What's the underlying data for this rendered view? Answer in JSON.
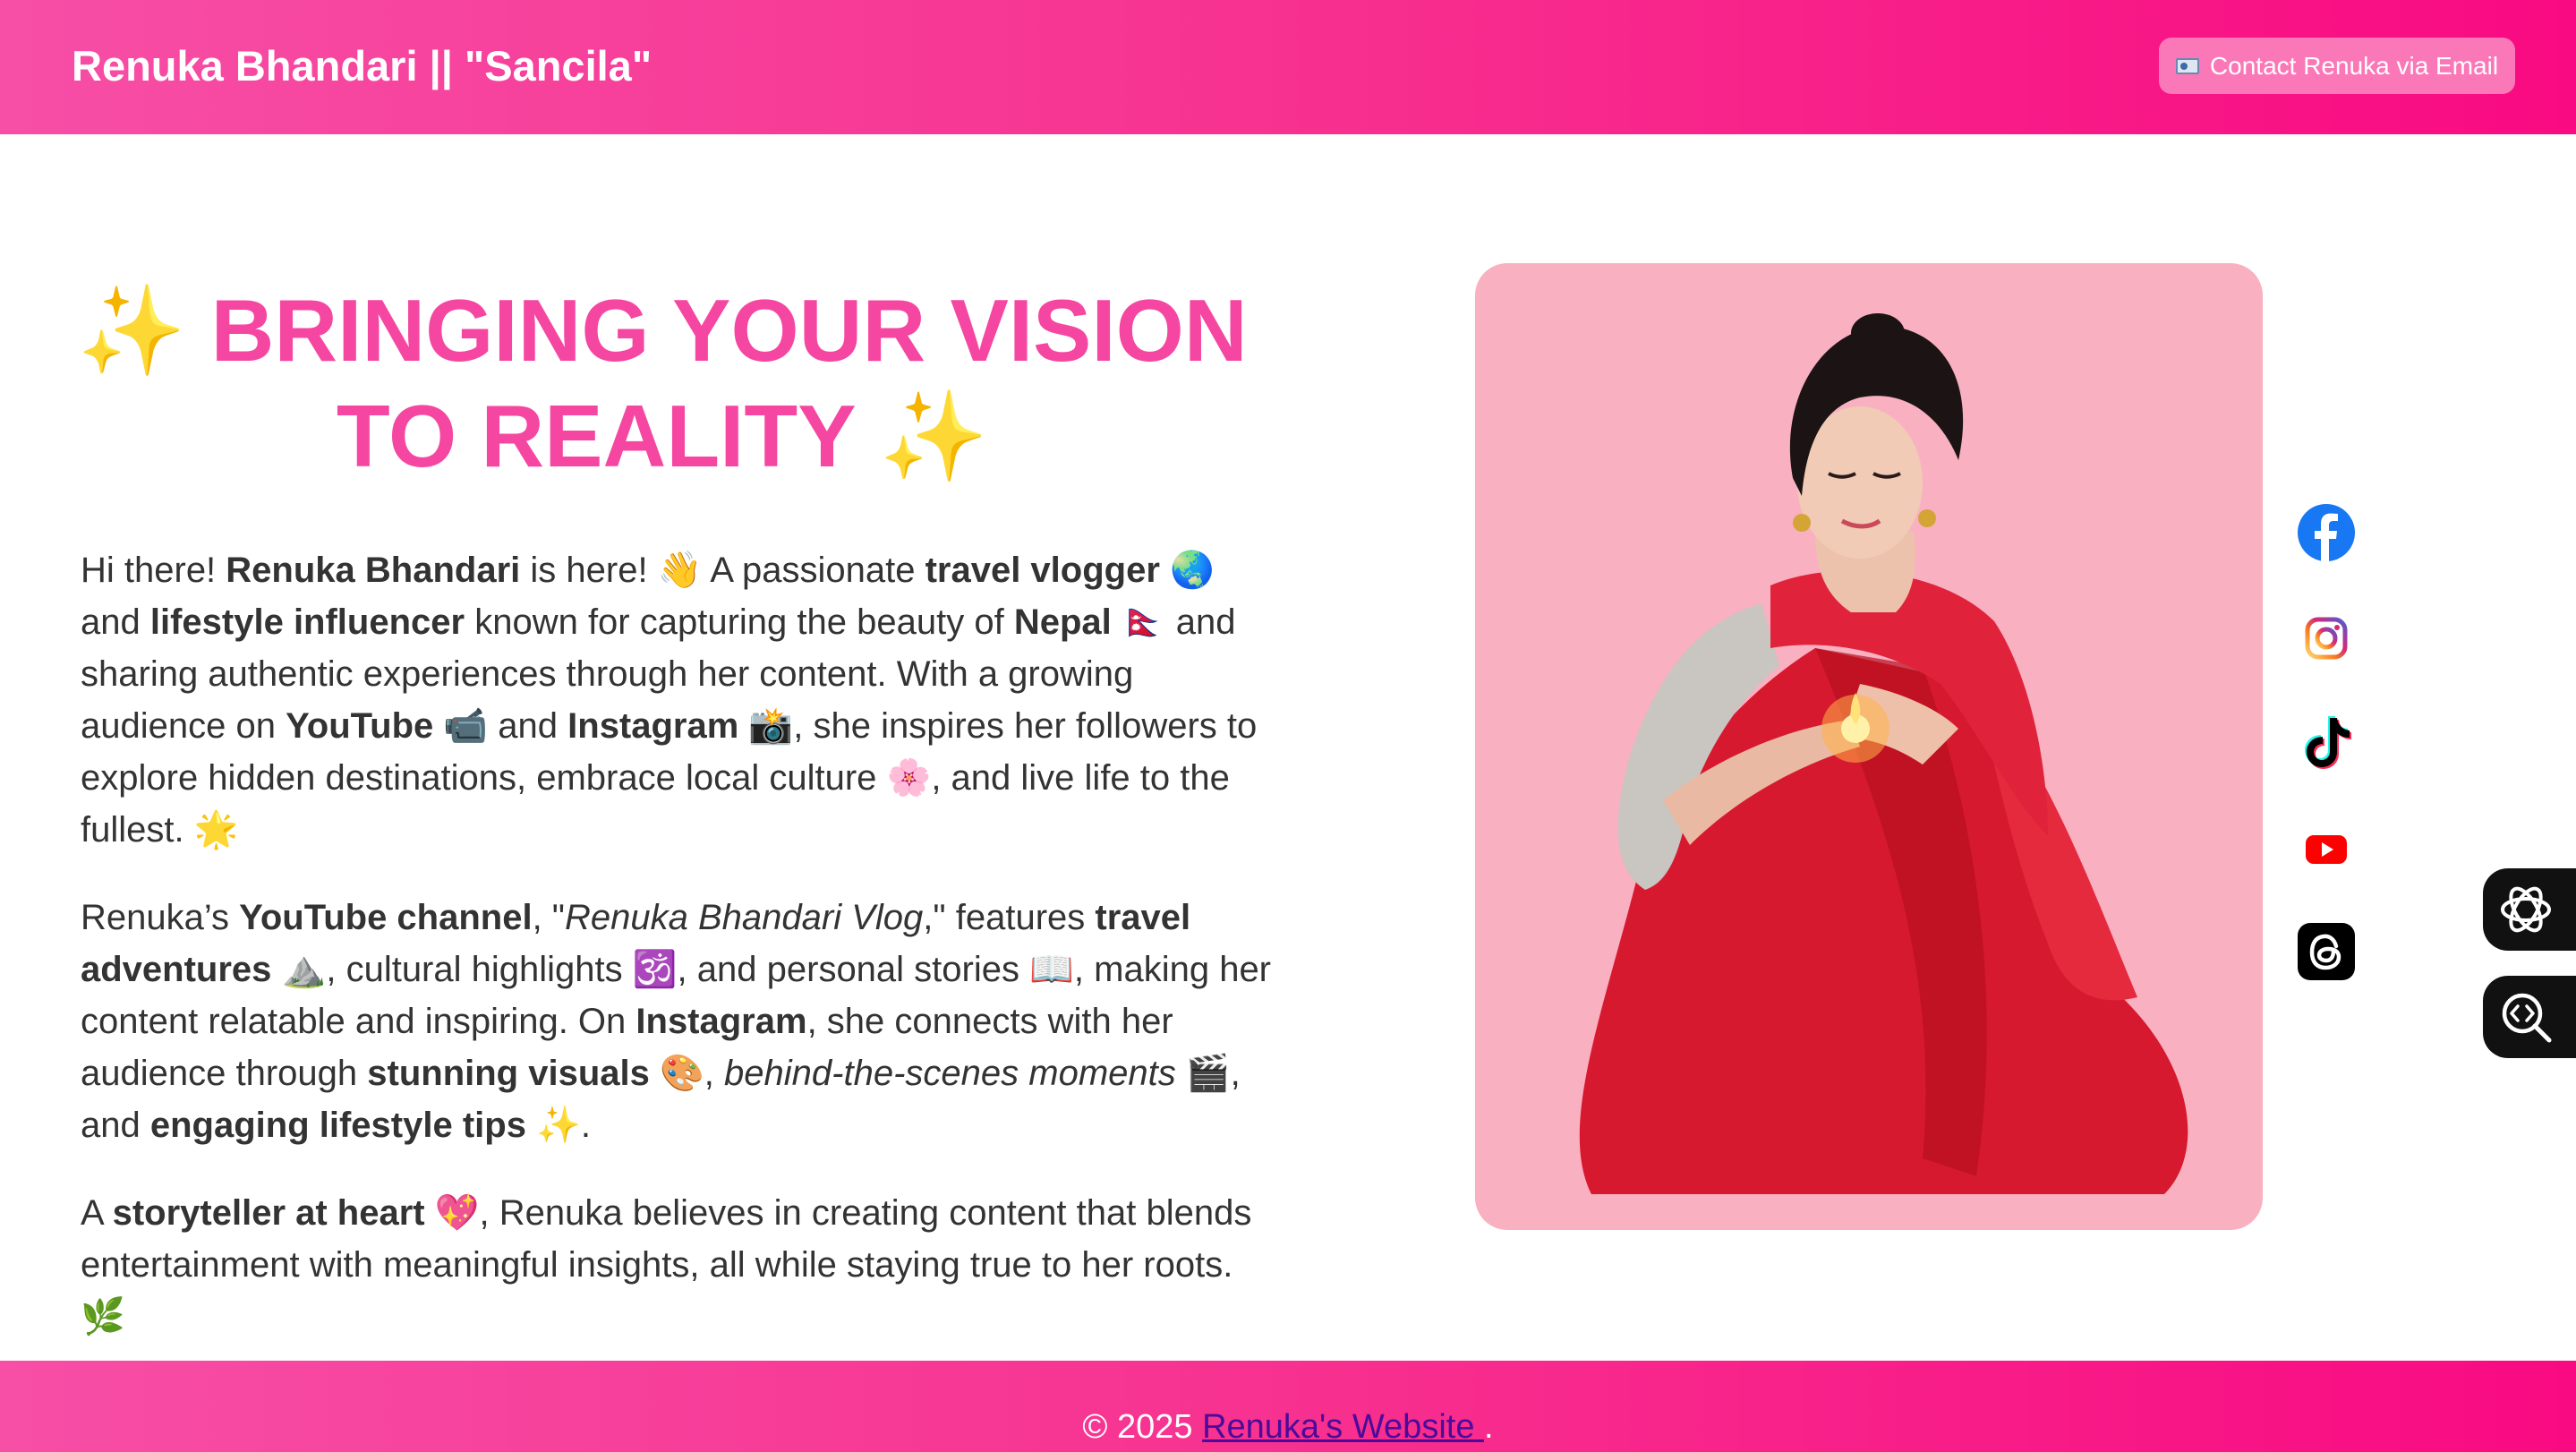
{
  "header": {
    "site_title": "Renuka Bhandari || \"Sancila\"",
    "contact_button_label": "Contact Renuka via Email",
    "contact_button_icon": "email-card-icon"
  },
  "hero": {
    "headline_line1": "BRINGING YOUR VISION",
    "headline_line2": "TO REALITY",
    "sparkle": "✨"
  },
  "about": {
    "p1": {
      "a": "Hi there! ",
      "name": "Renuka Bhandari",
      "b": " is here! 👋 A passionate ",
      "travel_vlogger": "travel vlogger",
      "c": " 🌏 and ",
      "lifestyle_influencer": "lifestyle influencer",
      "d": " known for capturing the beauty of ",
      "nepal": "Nepal",
      "e": " 🇳🇵 and sharing authentic experiences through her content. With a growing audience on ",
      "youtube": "YouTube",
      "f": " 📹 and ",
      "instagram": "Instagram",
      "g": " 📸, she inspires her followers to explore hidden destinations, embrace local culture 🌸, and live life to the fullest. 🌟"
    },
    "p2": {
      "a": "Renuka’s ",
      "youtube_channel": "YouTube channel",
      "b": ", \"",
      "vlog_name": "Renuka Bhandari Vlog",
      "c": ",\" features ",
      "travel_adventures": "travel adventures",
      "d": " ⛰️, cultural highlights 🕉️, and personal stories 📖, making her content relatable and inspiring. On ",
      "instagram": "Instagram",
      "e": ", she connects with her audience through ",
      "stunning_visuals": "stunning visuals",
      "f": " 🎨, ",
      "behind_scenes": "behind-the-scenes moments",
      "g": " 🎬, and ",
      "lifestyle_tips": "engaging lifestyle tips",
      "h": " ✨."
    },
    "p3": {
      "a": "A ",
      "storyteller": "storyteller at heart",
      "b": " 💖, Renuka believes in creating content that blends entertainment with meaningful insights, all while staying true to her roots. 🌿"
    }
  },
  "photo": {
    "subject": "portrait of woman in red saree holding a small oil lamp",
    "background_color": "#f9b0c1"
  },
  "social_links": [
    "facebook-icon",
    "instagram-icon",
    "tiktok-icon",
    "youtube-icon",
    "threads-icon"
  ],
  "side_widgets": [
    "ai-assistant-icon",
    "code-search-icon"
  ],
  "footer": {
    "copyright": "© 2025 ",
    "link_text": "Renuka's Website ",
    "end": "."
  },
  "colors": {
    "brand_pink": "#f547a2",
    "header_gradient_start": "#f74ea6",
    "header_gradient_end": "#f90a82",
    "link_purple": "#4b0a9a"
  }
}
